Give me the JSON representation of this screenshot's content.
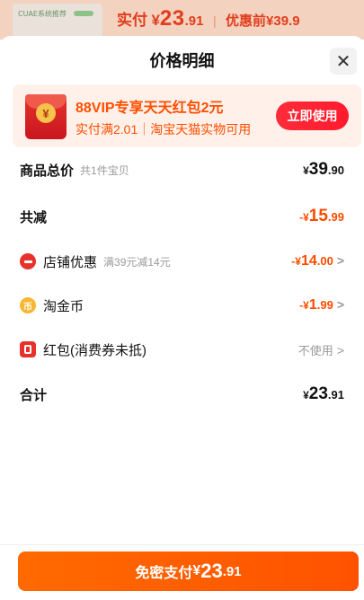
{
  "background": {
    "thumb_text": "CUAE系统推荐",
    "price_label": "实付",
    "currency": "¥",
    "price_int": "23",
    "price_dec": ".91",
    "separator": "|",
    "original_label": "优惠前¥39.9"
  },
  "sheet": {
    "title": "价格明细",
    "close_glyph": "✕"
  },
  "vip_banner": {
    "coin_glyph": "¥",
    "title": "88VIP专享天天红包2元",
    "subtitle": "实付满2.01｜淘宝天猫实物可用",
    "button": "立即使用"
  },
  "rows": {
    "total": {
      "label": "商品总价",
      "note": "共1件宝贝",
      "currency": "¥",
      "int": "39",
      "dec": ".90"
    },
    "discount": {
      "label": "共减",
      "currency": "-¥",
      "int": "15",
      "dec": ".99"
    },
    "store": {
      "label": "店铺优惠",
      "note": "满39元减14元",
      "currency": "-¥",
      "int": "14",
      "dec": ".00",
      "chevron": ">"
    },
    "coins": {
      "label": "淘金币",
      "icon_glyph": "币",
      "currency": "-¥",
      "int": "1",
      "dec": ".99",
      "chevron": ">"
    },
    "redpacket": {
      "label": "红包(消费券未抵)",
      "value": "不使用",
      "chevron": ">"
    },
    "sum": {
      "label": "合计",
      "currency": "¥",
      "int": "23",
      "dec": ".91"
    }
  },
  "pay_button": {
    "label": "免密支付",
    "currency": "¥",
    "int": "23",
    "dec": ".91"
  },
  "colors": {
    "accent": "#ff5200",
    "red": "#ff4b00",
    "vip_bg": "#fff1ea"
  }
}
